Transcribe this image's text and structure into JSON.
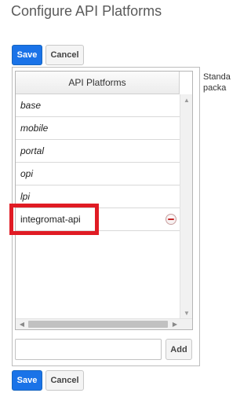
{
  "page": {
    "title": "Configure API Platforms"
  },
  "toolbar_top": {
    "save_label": "Save",
    "cancel_label": "Cancel"
  },
  "toolbar_bottom": {
    "save_label": "Save",
    "cancel_label": "Cancel"
  },
  "side_text_lines": [
    "Standa",
    "packa"
  ],
  "grid": {
    "header": "API Platforms",
    "rows": [
      {
        "label": "base",
        "editable": false
      },
      {
        "label": "mobile",
        "editable": false
      },
      {
        "label": "portal",
        "editable": false
      },
      {
        "label": "opi",
        "editable": false
      },
      {
        "label": "lpi",
        "editable": false
      },
      {
        "label": "integromat-api",
        "editable": true
      }
    ]
  },
  "add_form": {
    "input_value": "",
    "add_label": "Add"
  },
  "colors": {
    "primary": "#1a73e8",
    "highlight": "#e01b24",
    "remove": "#c62828"
  },
  "icons": {
    "remove": "minus-circle-icon",
    "scroll_up": "up-arrow-icon",
    "scroll_down": "down-arrow-icon",
    "scroll_left": "left-arrow-icon",
    "scroll_right": "right-arrow-icon"
  }
}
